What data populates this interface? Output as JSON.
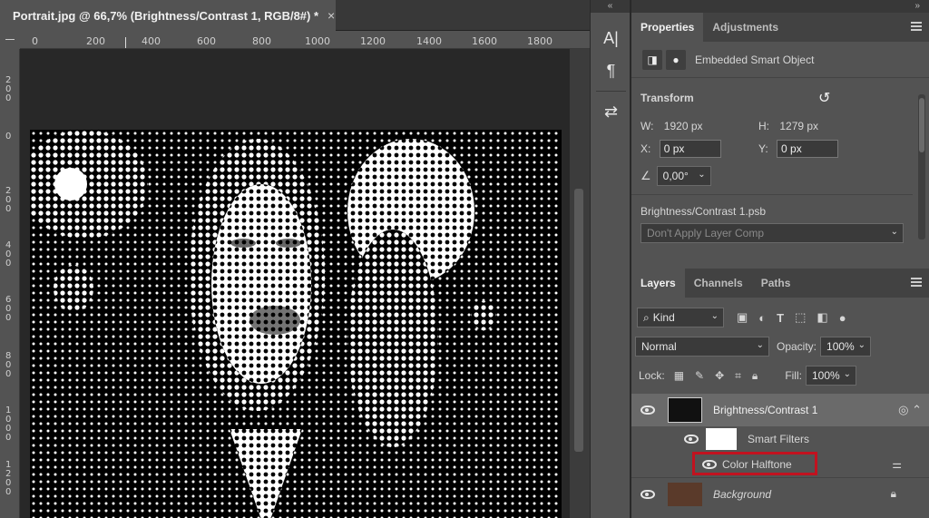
{
  "document": {
    "tab_title": "Portrait.jpg @ 66,7% (Brightness/Contrast 1, RGB/8#) *",
    "tab_close": "×"
  },
  "ruler_top": [
    "0",
    "200",
    "400",
    "600",
    "800",
    "1000",
    "1200",
    "1400",
    "1600",
    "1800"
  ],
  "ruler_left": [
    "200",
    "0",
    "200",
    "400",
    "600",
    "800",
    "1000",
    "1200"
  ],
  "strip": {
    "collapse": "«",
    "tools": [
      {
        "icon": "character-icon",
        "glyph": "A|"
      },
      {
        "icon": "paragraph-icon",
        "glyph": "¶"
      },
      {
        "icon": "glyph-history-icon",
        "glyph": "⇄"
      }
    ]
  },
  "panel": {
    "collapse": "»",
    "top_tabs": [
      "Properties",
      "Adjustments"
    ],
    "smart_object_label": "Embedded Smart Object",
    "transform_title": "Transform",
    "w_label": "W:",
    "w_value": "1920 px",
    "h_label": "H:",
    "h_value": "1279 px",
    "x_label": "X:",
    "x_value": "0 px",
    "y_label": "Y:",
    "y_value": "0 px",
    "angle_value": "0,00°",
    "filename": "Brightness/Contrast 1.psb",
    "layer_comp": "Don't Apply Layer Comp"
  },
  "layers_panel": {
    "tabs": [
      "Layers",
      "Channels",
      "Paths"
    ],
    "kind_label": "Kind",
    "blend_mode": "Normal",
    "opacity_label": "Opacity:",
    "opacity_value": "100%",
    "lock_label": "Lock:",
    "fill_label": "Fill:",
    "fill_value": "100%",
    "layers": [
      {
        "name": "Brightness/Contrast 1"
      },
      {
        "name": "Smart Filters"
      },
      {
        "name": "Color Halftone"
      },
      {
        "name": "Background"
      }
    ]
  },
  "colors": {
    "highlight": "#c1121f",
    "panel_bg": "#535353",
    "canvas_bg": "#282828"
  }
}
